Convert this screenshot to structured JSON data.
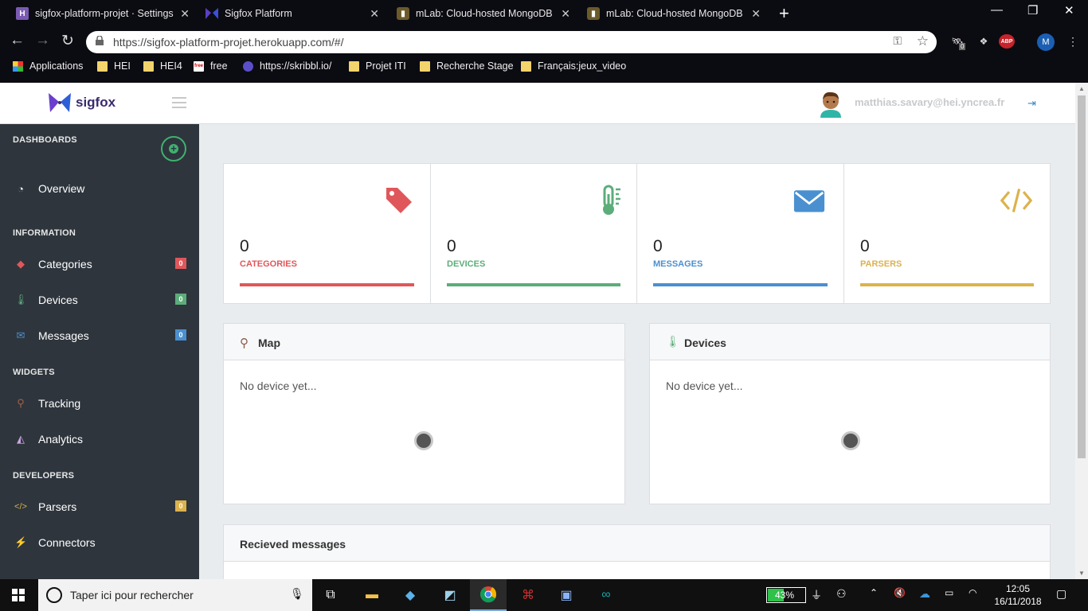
{
  "browser": {
    "tabs": [
      {
        "title": "sigfox-platform-projet · Settings",
        "favicon": "H"
      },
      {
        "title": "Sigfox Platform",
        "favicon": "sigfox-logo"
      },
      {
        "title": "mLab: Cloud-hosted MongoDB",
        "favicon": "mlab-logo"
      },
      {
        "title": "mLab: Cloud-hosted MongoDB",
        "favicon": "mlab-logo"
      }
    ],
    "url": "https://sigfox-platform-projet.herokuapp.com/#/",
    "extension_badge": "0",
    "abp_label": "ABP",
    "profile_initial": "M",
    "bookmarks": [
      "Applications",
      "HEI",
      "HEI4",
      "free",
      "https://skribbl.io/",
      "Projet ITI",
      "Recherche Stage",
      "Français:jeux_video"
    ],
    "free_icon_label": "free"
  },
  "header": {
    "brand": "sigfox",
    "user_email": "matthias.savary@hei.yncrea.fr"
  },
  "sidebar": {
    "sections": {
      "dashboards": "DASHBOARDS",
      "information": "INFORMATION",
      "widgets": "WIDGETS",
      "developers": "DEVELOPERS"
    },
    "items": {
      "overview": "Overview",
      "categories": "Categories",
      "devices": "Devices",
      "messages": "Messages",
      "tracking": "Tracking",
      "analytics": "Analytics",
      "parsers": "Parsers",
      "connectors": "Connectors"
    },
    "badges": {
      "categories": "0",
      "devices": "0",
      "messages": "0",
      "parsers": "0"
    }
  },
  "stats": {
    "categories": {
      "value": "0",
      "label": "CATEGORIES",
      "color": "#e0575b"
    },
    "devices": {
      "value": "0",
      "label": "DEVICES",
      "color": "#5cad7a"
    },
    "messages": {
      "value": "0",
      "label": "MESSAGES",
      "color": "#4a90d0"
    },
    "parsers": {
      "value": "0",
      "label": "PARSERS",
      "color": "#dcb24c"
    }
  },
  "panels": {
    "map": {
      "title": "Map",
      "empty": "No device yet..."
    },
    "devices": {
      "title": "Devices",
      "empty": "No device yet..."
    },
    "messages": {
      "title": "Recieved messages"
    }
  },
  "taskbar": {
    "search_placeholder": "Taper ici pour rechercher",
    "battery": "43%",
    "time": "12:05",
    "date": "16/11/2018"
  }
}
